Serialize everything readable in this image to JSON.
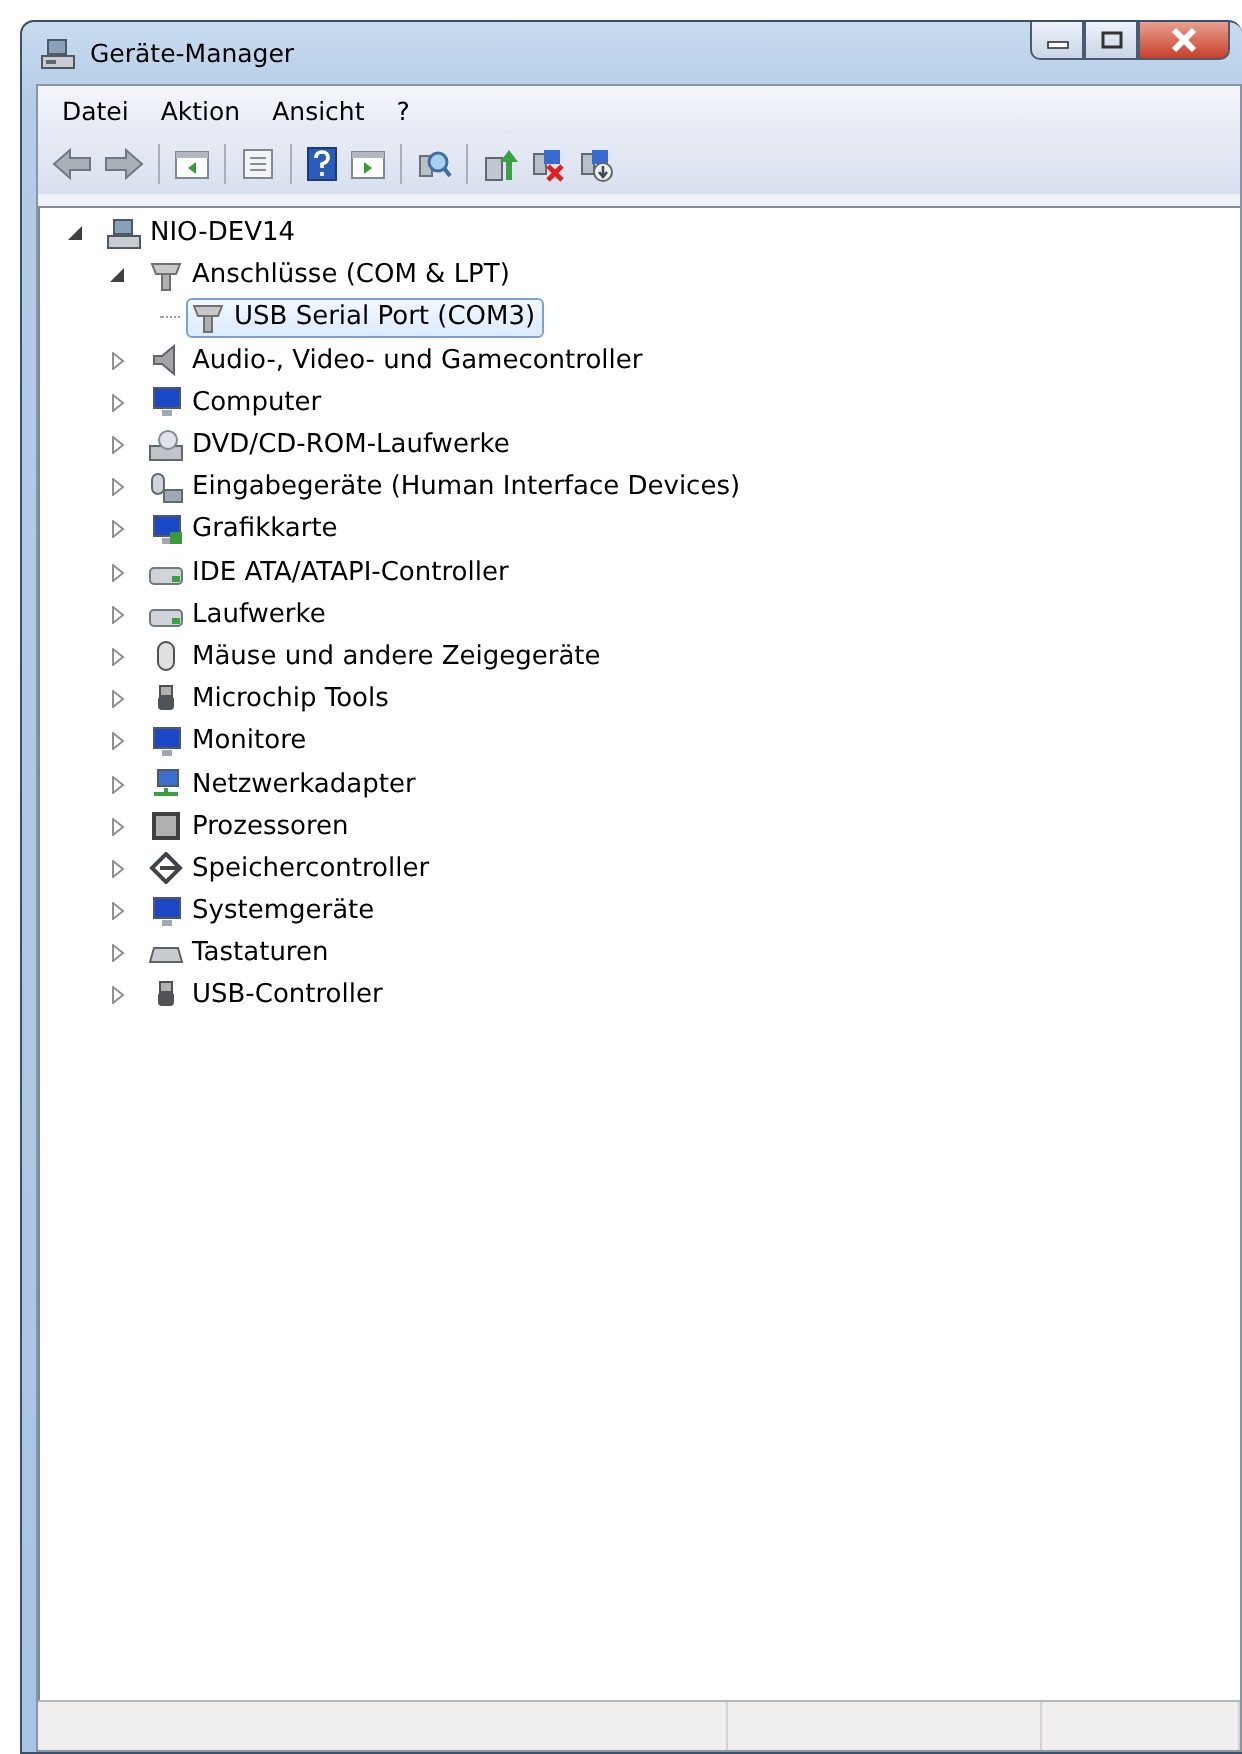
{
  "window": {
    "title": "Geräte-Manager"
  },
  "menu": [
    {
      "label": "Datei"
    },
    {
      "label": "Aktion"
    },
    {
      "label": "Ansicht"
    },
    {
      "label": "?"
    }
  ],
  "tree": {
    "root": {
      "label": "NIO-DEV14",
      "expanded": true,
      "selected": false,
      "children": [
        {
          "label": "Anschlüsse (COM & LPT)",
          "expanded": true,
          "selected": false,
          "children": [
            {
              "label": "USB Serial Port (COM3)",
              "selected": true
            }
          ]
        },
        {
          "label": "Audio-, Video- und Gamecontroller",
          "expanded": false,
          "selected": false
        },
        {
          "label": "Computer",
          "expanded": false,
          "selected": false
        },
        {
          "label": "DVD/CD-ROM-Laufwerke",
          "expanded": false,
          "selected": false
        },
        {
          "label": "Eingabegeräte (Human Interface Devices)",
          "expanded": false,
          "selected": false
        },
        {
          "label": "Grafikkarte",
          "expanded": false,
          "selected": false
        },
        {
          "label": "IDE ATA/ATAPI-Controller",
          "expanded": false,
          "selected": false
        },
        {
          "label": "Laufwerke",
          "expanded": false,
          "selected": false
        },
        {
          "label": "Mäuse und andere Zeigegeräte",
          "expanded": false,
          "selected": false
        },
        {
          "label": "Microchip Tools",
          "expanded": false,
          "selected": false
        },
        {
          "label": "Monitore",
          "expanded": false,
          "selected": false
        },
        {
          "label": "Netzwerkadapter",
          "expanded": false,
          "selected": false
        },
        {
          "label": "Prozessoren",
          "expanded": false,
          "selected": false
        },
        {
          "label": "Speichercontroller",
          "expanded": false,
          "selected": false
        },
        {
          "label": "Systemgeräte",
          "expanded": false,
          "selected": false
        },
        {
          "label": "Tastaturen",
          "expanded": false,
          "selected": false
        },
        {
          "label": "USB-Controller",
          "expanded": false,
          "selected": false
        }
      ]
    }
  }
}
